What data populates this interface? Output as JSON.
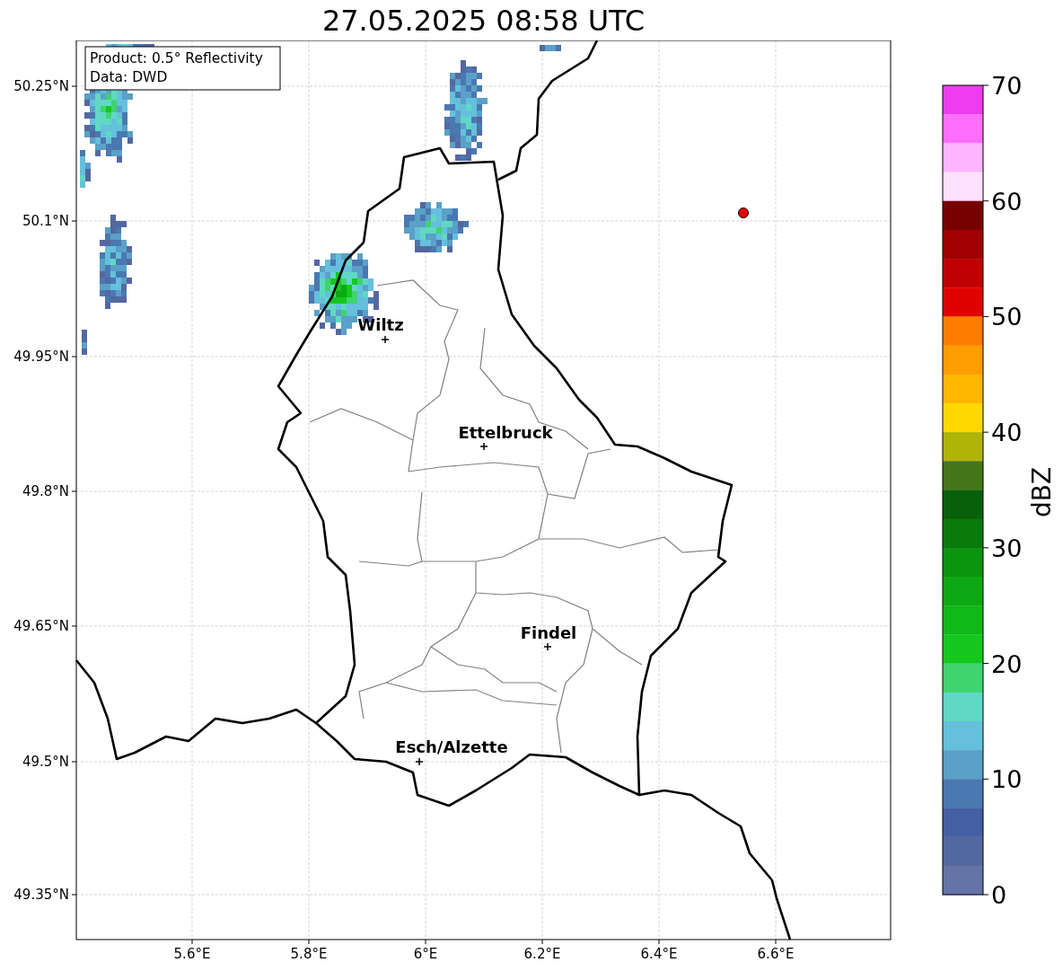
{
  "title": "27.05.2025 08:58 UTC",
  "info_box": {
    "lines": [
      "Product: 0.5° Reflectivity",
      "Data: DWD"
    ]
  },
  "map": {
    "y_ticks": [
      "50.25°N",
      "50.1°N",
      "49.95°N",
      "49.8°N",
      "49.65°N",
      "49.5°N",
      "49.35°N"
    ],
    "x_ticks": [
      "5.6°E",
      "5.8°E",
      "6°E",
      "6.2°E",
      "6.4°E",
      "6.6°E"
    ],
    "cities": [
      {
        "name": "Wiltz"
      },
      {
        "name": "Ettelbruck"
      },
      {
        "name": "Findel"
      },
      {
        "name": "Esch/Alzette"
      }
    ]
  },
  "colorbar": {
    "label": "dBZ",
    "ticks": [
      "70",
      "60",
      "50",
      "40",
      "30",
      "20",
      "10",
      "0"
    ],
    "bins": [
      {
        "color": "#ee3cee"
      },
      {
        "color": "#ff6eff"
      },
      {
        "color": "#ffb4ff"
      },
      {
        "color": "#ffe0ff"
      },
      {
        "color": "#780000"
      },
      {
        "color": "#a00000"
      },
      {
        "color": "#c00000"
      },
      {
        "color": "#e00000"
      },
      {
        "color": "#ff7c00"
      },
      {
        "color": "#ff9c00"
      },
      {
        "color": "#ffb800"
      },
      {
        "color": "#ffd800"
      },
      {
        "color": "#b0b408"
      },
      {
        "color": "#44761a"
      },
      {
        "color": "#08600a"
      },
      {
        "color": "#0a7a0c"
      },
      {
        "color": "#0c9410"
      },
      {
        "color": "#0ea814"
      },
      {
        "color": "#10b818"
      },
      {
        "color": "#14c81e"
      },
      {
        "color": "#3ed46e"
      },
      {
        "color": "#60d8c4"
      },
      {
        "color": "#64c0dc"
      },
      {
        "color": "#5aa0c8"
      },
      {
        "color": "#4a78b0"
      },
      {
        "color": "#4460a2"
      },
      {
        "color": "#5468a0"
      },
      {
        "color": "#6474a6"
      }
    ]
  }
}
